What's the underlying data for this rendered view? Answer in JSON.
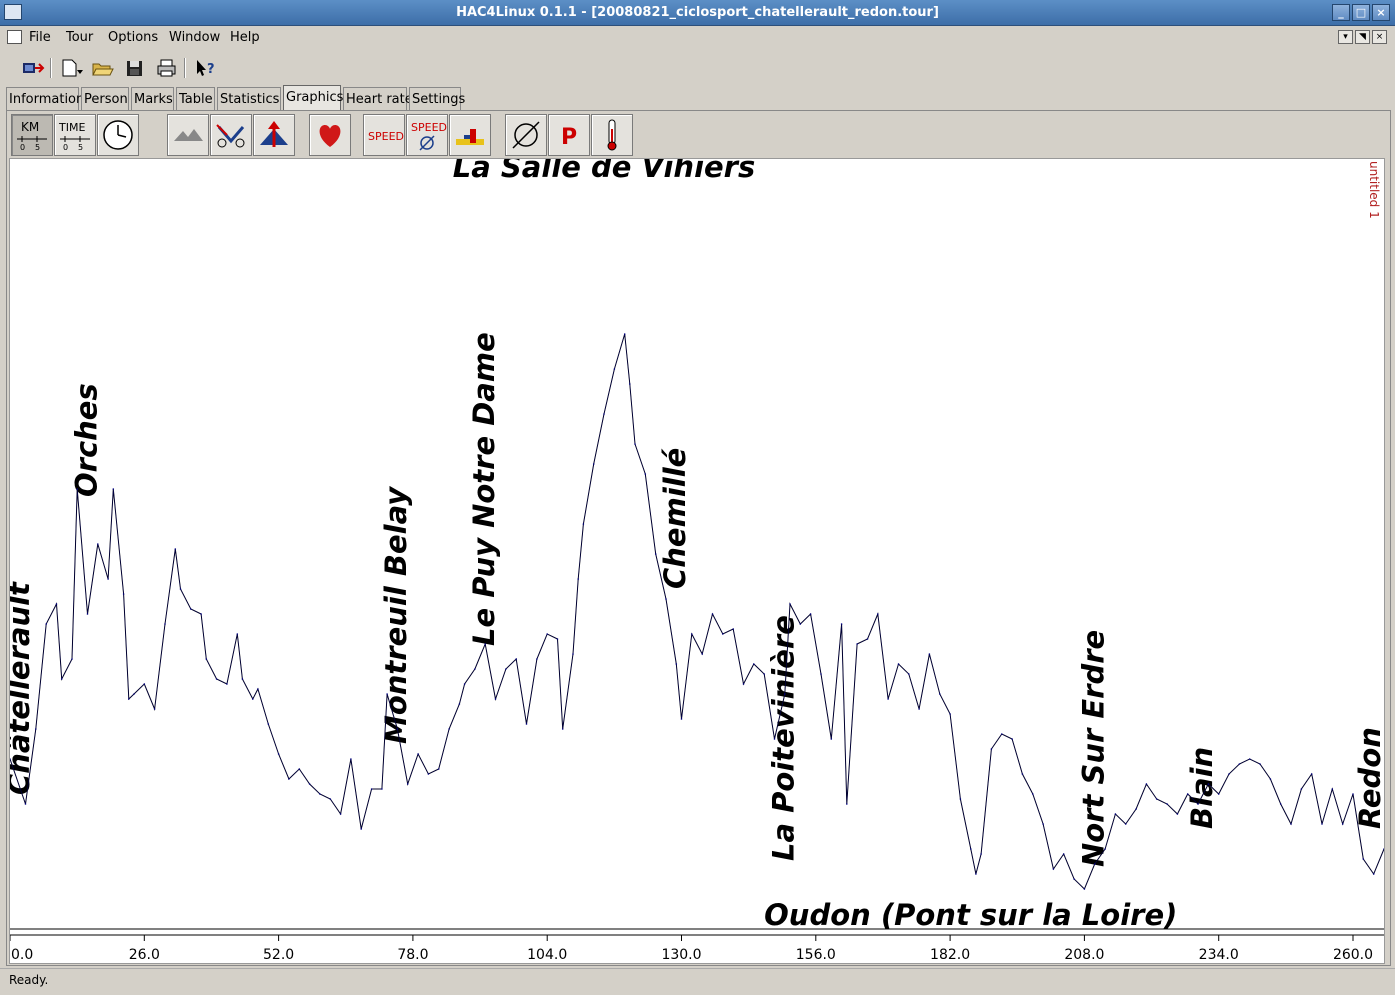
{
  "window": {
    "title": "HAC4Linux 0.1.1 - [20080821_ciclosport_chatellerault_redon.tour]",
    "controls": [
      "minimize",
      "maximize",
      "close"
    ]
  },
  "menubar": {
    "items": [
      {
        "label": "File",
        "name": "menu-file"
      },
      {
        "label": "Tour",
        "name": "menu-tour"
      },
      {
        "label": "Options",
        "name": "menu-options"
      },
      {
        "label": "Window",
        "name": "menu-window"
      },
      {
        "label": "Help",
        "name": "menu-help"
      }
    ]
  },
  "toolbar": {
    "icons": [
      "transfer-icon",
      "new-document-icon",
      "open-folder-icon",
      "save-icon",
      "print-icon",
      "context-help-icon"
    ]
  },
  "tabs": [
    {
      "label": "Information",
      "active": false
    },
    {
      "label": "Person",
      "active": false
    },
    {
      "label": "Marks",
      "active": false
    },
    {
      "label": "Table",
      "active": false
    },
    {
      "label": "Statistics",
      "active": false
    },
    {
      "label": "Graphics",
      "active": true
    },
    {
      "label": "Heart rate",
      "active": false
    },
    {
      "label": "Settings",
      "active": false
    }
  ],
  "graph_toolbar": {
    "km_label": "KM",
    "time_label": "TIME",
    "speed_label": "SPEED",
    "avg_speed_label": "SPEED",
    "power_label": "P"
  },
  "graph": {
    "series_label": "untitled 1",
    "line_color": "#000080",
    "trace_color": "#000000"
  },
  "chart_data": {
    "type": "line",
    "title": "",
    "xlabel": "",
    "ylabel": "",
    "xlim": [
      0,
      266
    ],
    "x_ticks": [
      "0.0",
      "26.0",
      "52.0",
      "78.0",
      "104.0",
      "130.0",
      "156.0",
      "182.0",
      "208.0",
      "234.0",
      "260.0"
    ],
    "grid": false,
    "series": [
      {
        "name": "untitled 1",
        "x": [
          0,
          3,
          5,
          7,
          9,
          10,
          12,
          13,
          15,
          17,
          19,
          20,
          22,
          23,
          24,
          26,
          28,
          30,
          32,
          33,
          35,
          37,
          38,
          40,
          42,
          44,
          45,
          47,
          48,
          50,
          52,
          54,
          56,
          58,
          60,
          62,
          64,
          66,
          68,
          70,
          72,
          73,
          75,
          77,
          79,
          81,
          83,
          85,
          87,
          88,
          90,
          92,
          94,
          96,
          98,
          100,
          102,
          104,
          106,
          107,
          109,
          110,
          111,
          113,
          115,
          117,
          119,
          120,
          121,
          123,
          125,
          127,
          129,
          130,
          132,
          134,
          136,
          138,
          140,
          142,
          144,
          146,
          148,
          150,
          151,
          153,
          155,
          157,
          159,
          161,
          162,
          164,
          166,
          168,
          170,
          172,
          174,
          176,
          178,
          180,
          182,
          184,
          186,
          187,
          188,
          190,
          192,
          194,
          196,
          198,
          200,
          202,
          204,
          206,
          208,
          210,
          212,
          214,
          216,
          218,
          220,
          222,
          224,
          226,
          228,
          230,
          232,
          234,
          236,
          238,
          240,
          242,
          244,
          246,
          248,
          250,
          252,
          254,
          256,
          258,
          260,
          262,
          264,
          266
        ],
        "y": [
          175,
          130,
          205,
          310,
          330,
          255,
          275,
          445,
          320,
          390,
          355,
          445,
          340,
          235,
          240,
          250,
          225,
          310,
          385,
          345,
          325,
          320,
          275,
          255,
          250,
          300,
          255,
          235,
          245,
          210,
          180,
          155,
          165,
          150,
          140,
          135,
          120,
          175,
          105,
          145,
          145,
          240,
          205,
          150,
          180,
          160,
          165,
          205,
          230,
          250,
          265,
          290,
          235,
          265,
          275,
          210,
          275,
          300,
          295,
          205,
          280,
          355,
          410,
          470,
          520,
          565,
          600,
          550,
          490,
          460,
          380,
          335,
          270,
          215,
          300,
          280,
          320,
          300,
          305,
          250,
          270,
          260,
          195,
          240,
          330,
          310,
          320,
          260,
          195,
          310,
          130,
          290,
          295,
          320,
          235,
          270,
          260,
          225,
          280,
          240,
          220,
          135,
          85,
          60,
          80,
          185,
          200,
          195,
          160,
          140,
          110,
          65,
          80,
          55,
          45,
          70,
          85,
          120,
          110,
          125,
          150,
          135,
          130,
          120,
          140,
          130,
          150,
          140,
          160,
          170,
          175,
          170,
          155,
          130,
          110,
          145,
          160,
          110,
          145,
          110,
          140,
          75,
          60,
          85
        ]
      }
    ],
    "annotations": [
      {
        "text": "Châtellerault",
        "x": 1
      },
      {
        "text": "Orches",
        "x": 14
      },
      {
        "text": "Montreuil Belay",
        "x": 74
      },
      {
        "text": "Le Puy Notre Dame",
        "x": 91
      },
      {
        "text": "La Salle de Vihiers",
        "x": 115
      },
      {
        "text": "Chemillé",
        "x": 128
      },
      {
        "text": "La Poitevinière",
        "x": 149
      },
      {
        "text": "Oudon (Pont sur la Loire)",
        "x": 186
      },
      {
        "text": "Nort Sur Erdre",
        "x": 209
      },
      {
        "text": "Blain",
        "x": 230
      },
      {
        "text": "Redon",
        "x": 264
      }
    ]
  },
  "statusbar": {
    "text": "Ready."
  }
}
